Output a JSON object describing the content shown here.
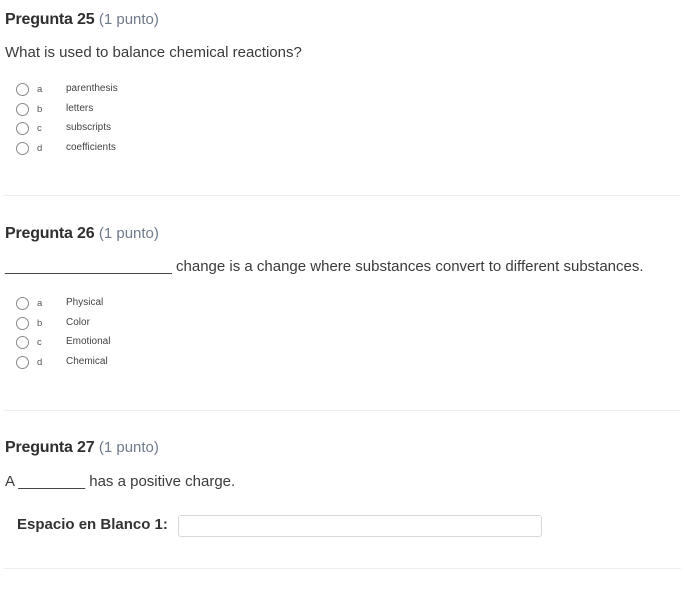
{
  "questions": [
    {
      "title": "Pregunta 25",
      "points": "(1 punto)",
      "text": "What is used to balance chemical reactions?",
      "options": [
        {
          "letter": "a",
          "text": "parenthesis"
        },
        {
          "letter": "b",
          "text": "letters"
        },
        {
          "letter": "c",
          "text": "subscripts"
        },
        {
          "letter": "d",
          "text": "coefficients"
        }
      ]
    },
    {
      "title": "Pregunta 26",
      "points": "(1 punto)",
      "text": "____________________ change is a change where substances convert to different substances.",
      "options": [
        {
          "letter": "a",
          "text": "Physical"
        },
        {
          "letter": "b",
          "text": "Color"
        },
        {
          "letter": "c",
          "text": "Emotional"
        },
        {
          "letter": "d",
          "text": "Chemical"
        }
      ]
    },
    {
      "title": "Pregunta 27",
      "points": "(1 punto)",
      "text": "A  ________ has a positive charge.",
      "blank_label": "Espacio en Blanco 1:",
      "blank_value": ""
    }
  ]
}
